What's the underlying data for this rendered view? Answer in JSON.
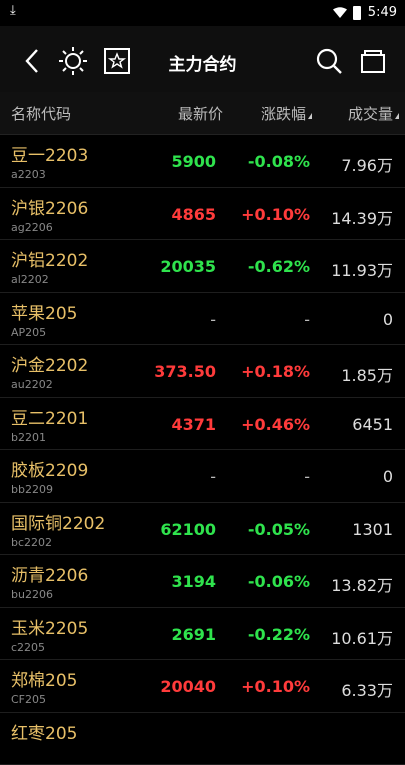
{
  "status": {
    "time": "5:49",
    "download_icon": "download-arrow-icon"
  },
  "header": {
    "title": "主力合约"
  },
  "columns": {
    "name": "名称代码",
    "price": "最新价",
    "change": "涨跌幅",
    "volume": "成交量"
  },
  "colors": {
    "up": "#ff3b3b",
    "down": "#2fe34d",
    "name": "#e8c068"
  },
  "rows": [
    {
      "name": "豆一2203",
      "code": "a2203",
      "price": "5900",
      "change": "-0.08%",
      "volume": "7.96万",
      "dir": "down"
    },
    {
      "name": "沪银2206",
      "code": "ag2206",
      "price": "4865",
      "change": "+0.10%",
      "volume": "14.39万",
      "dir": "up"
    },
    {
      "name": "沪铝2202",
      "code": "al2202",
      "price": "20035",
      "change": "-0.62%",
      "volume": "11.93万",
      "dir": "down"
    },
    {
      "name": "苹果205",
      "code": "AP205",
      "price": "-",
      "change": "-",
      "volume": "0",
      "dir": "flat"
    },
    {
      "name": "沪金2202",
      "code": "au2202",
      "price": "373.50",
      "change": "+0.18%",
      "volume": "1.85万",
      "dir": "up"
    },
    {
      "name": "豆二2201",
      "code": "b2201",
      "price": "4371",
      "change": "+0.46%",
      "volume": "6451",
      "dir": "up"
    },
    {
      "name": "胶板2209",
      "code": "bb2209",
      "price": "-",
      "change": "-",
      "volume": "0",
      "dir": "flat"
    },
    {
      "name": "国际铜2202",
      "code": "bc2202",
      "price": "62100",
      "change": "-0.05%",
      "volume": "1301",
      "dir": "down"
    },
    {
      "name": "沥青2206",
      "code": "bu2206",
      "price": "3194",
      "change": "-0.06%",
      "volume": "13.82万",
      "dir": "down"
    },
    {
      "name": "玉米2205",
      "code": "c2205",
      "price": "2691",
      "change": "-0.22%",
      "volume": "10.61万",
      "dir": "down"
    },
    {
      "name": "郑棉205",
      "code": "CF205",
      "price": "20040",
      "change": "+0.10%",
      "volume": "6.33万",
      "dir": "up"
    },
    {
      "name": "红枣205",
      "code": "",
      "price": "",
      "change": "",
      "volume": "",
      "dir": "flat"
    }
  ]
}
